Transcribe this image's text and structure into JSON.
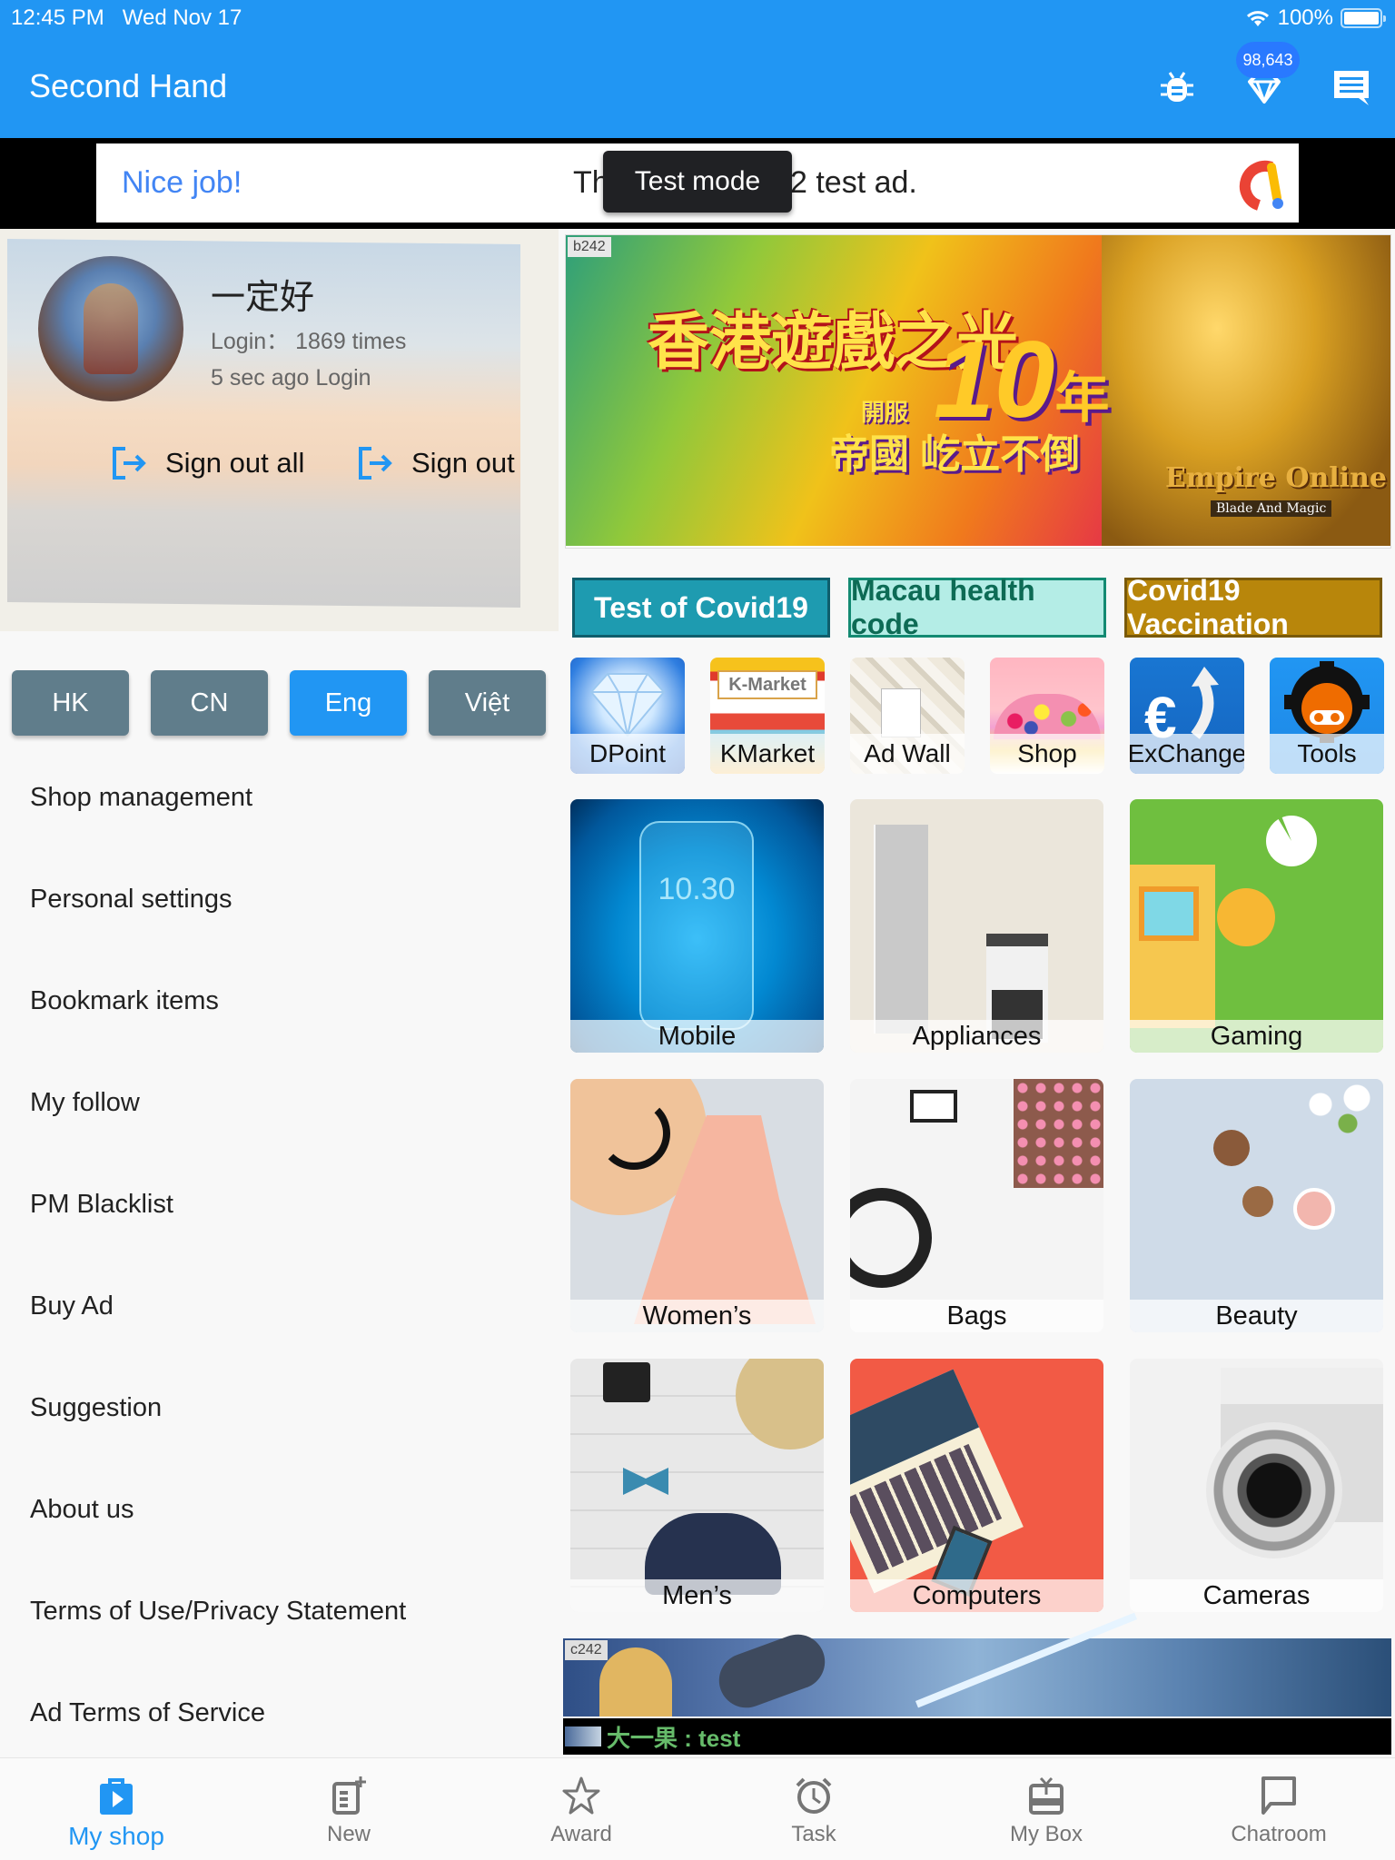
{
  "status_bar": {
    "time": "12:45 PM",
    "date": "Wed Nov 17",
    "battery": "100%"
  },
  "app_bar": {
    "title": "Second Hand",
    "points_badge": "98,643"
  },
  "ad": {
    "headline": "Nice job!",
    "text": "This is a 2 test ad.",
    "visible_text_left": "Th",
    "visible_text_right": "2 test ad.",
    "overlay": "Test mode"
  },
  "profile": {
    "username": "一定好",
    "login_count": "Login：  1869 times",
    "last_login": "5 sec  ago Login",
    "sign_out_all": "Sign out all",
    "sign_out": "Sign out"
  },
  "languages": [
    {
      "label": "HK",
      "active": false
    },
    {
      "label": "CN",
      "active": false
    },
    {
      "label": "Eng",
      "active": true
    },
    {
      "label": "Việt",
      "active": false
    }
  ],
  "menu": [
    "Shop management",
    "Personal settings",
    "Bookmark items",
    "My follow",
    "PM Blacklist",
    "Buy Ad",
    "Suggestion",
    "About us",
    "Terms of Use/Privacy Statement",
    "Ad Terms of Service"
  ],
  "banner": {
    "tag": "b242",
    "title_line1": "香港遊戲之光",
    "open_label": "開服",
    "years": "10",
    "year_char": "年",
    "title_line2": "帝國 屹立不倒",
    "logo": "Empire Online",
    "logo_sub": "Blade And Magic"
  },
  "covid_buttons": [
    {
      "label": "Test of Covid19",
      "bg": "#1e9bb0",
      "fg": "#ffffff",
      "border": "#0f5e6c"
    },
    {
      "label": "Macau health code",
      "bg": "#b4ede6",
      "fg": "#0d6b55",
      "border": "#138a72"
    },
    {
      "label": "Covid19 Vaccination",
      "bg": "#b8860b",
      "fg": "#ffffff",
      "border": "#7a5a08"
    }
  ],
  "quick_links": [
    {
      "label": "DPoint",
      "icon": "diamond-icon"
    },
    {
      "label": "KMarket",
      "icon": "kmarket-icon"
    },
    {
      "label": "Ad Wall",
      "icon": "ad-wall-icon"
    },
    {
      "label": "Shop",
      "icon": "flowers-icon"
    },
    {
      "label": "ExChange",
      "icon": "euro-exchange-icon"
    },
    {
      "label": "Tools",
      "icon": "gear-robot-icon"
    }
  ],
  "categories": [
    {
      "label": "Mobile"
    },
    {
      "label": "Appliances"
    },
    {
      "label": "Gaming"
    },
    {
      "label": "Women’s"
    },
    {
      "label": "Bags"
    },
    {
      "label": "Beauty"
    },
    {
      "label": "Men’s"
    },
    {
      "label": "Computers"
    },
    {
      "label": "Cameras"
    }
  ],
  "bottom_ad": {
    "tag": "c242",
    "caption": "大一果 : test"
  },
  "bottom_nav": [
    {
      "label": "My shop",
      "icon": "shopping-bag-icon",
      "active": true
    },
    {
      "label": "New",
      "icon": "new-post-icon",
      "active": false
    },
    {
      "label": "Award",
      "icon": "star-icon",
      "active": false
    },
    {
      "label": "Task",
      "icon": "alarm-clock-icon",
      "active": false
    },
    {
      "label": "My Box",
      "icon": "gift-box-icon",
      "active": false
    },
    {
      "label": "Chatroom",
      "icon": "chat-bubble-icon",
      "active": false
    }
  ]
}
